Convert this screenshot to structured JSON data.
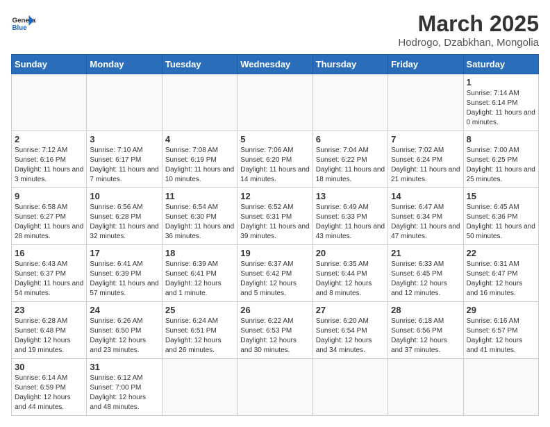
{
  "header": {
    "logo_general": "General",
    "logo_blue": "Blue",
    "main_title": "March 2025",
    "subtitle": "Hodrogo, Dzabkhan, Mongolia"
  },
  "weekdays": [
    "Sunday",
    "Monday",
    "Tuesday",
    "Wednesday",
    "Thursday",
    "Friday",
    "Saturday"
  ],
  "weeks": [
    [
      {
        "day": "",
        "info": ""
      },
      {
        "day": "",
        "info": ""
      },
      {
        "day": "",
        "info": ""
      },
      {
        "day": "",
        "info": ""
      },
      {
        "day": "",
        "info": ""
      },
      {
        "day": "",
        "info": ""
      },
      {
        "day": "1",
        "info": "Sunrise: 7:14 AM\nSunset: 6:14 PM\nDaylight: 11 hours and 0 minutes."
      }
    ],
    [
      {
        "day": "2",
        "info": "Sunrise: 7:12 AM\nSunset: 6:16 PM\nDaylight: 11 hours and 3 minutes."
      },
      {
        "day": "3",
        "info": "Sunrise: 7:10 AM\nSunset: 6:17 PM\nDaylight: 11 hours and 7 minutes."
      },
      {
        "day": "4",
        "info": "Sunrise: 7:08 AM\nSunset: 6:19 PM\nDaylight: 11 hours and 10 minutes."
      },
      {
        "day": "5",
        "info": "Sunrise: 7:06 AM\nSunset: 6:20 PM\nDaylight: 11 hours and 14 minutes."
      },
      {
        "day": "6",
        "info": "Sunrise: 7:04 AM\nSunset: 6:22 PM\nDaylight: 11 hours and 18 minutes."
      },
      {
        "day": "7",
        "info": "Sunrise: 7:02 AM\nSunset: 6:24 PM\nDaylight: 11 hours and 21 minutes."
      },
      {
        "day": "8",
        "info": "Sunrise: 7:00 AM\nSunset: 6:25 PM\nDaylight: 11 hours and 25 minutes."
      }
    ],
    [
      {
        "day": "9",
        "info": "Sunrise: 6:58 AM\nSunset: 6:27 PM\nDaylight: 11 hours and 28 minutes."
      },
      {
        "day": "10",
        "info": "Sunrise: 6:56 AM\nSunset: 6:28 PM\nDaylight: 11 hours and 32 minutes."
      },
      {
        "day": "11",
        "info": "Sunrise: 6:54 AM\nSunset: 6:30 PM\nDaylight: 11 hours and 36 minutes."
      },
      {
        "day": "12",
        "info": "Sunrise: 6:52 AM\nSunset: 6:31 PM\nDaylight: 11 hours and 39 minutes."
      },
      {
        "day": "13",
        "info": "Sunrise: 6:49 AM\nSunset: 6:33 PM\nDaylight: 11 hours and 43 minutes."
      },
      {
        "day": "14",
        "info": "Sunrise: 6:47 AM\nSunset: 6:34 PM\nDaylight: 11 hours and 47 minutes."
      },
      {
        "day": "15",
        "info": "Sunrise: 6:45 AM\nSunset: 6:36 PM\nDaylight: 11 hours and 50 minutes."
      }
    ],
    [
      {
        "day": "16",
        "info": "Sunrise: 6:43 AM\nSunset: 6:37 PM\nDaylight: 11 hours and 54 minutes."
      },
      {
        "day": "17",
        "info": "Sunrise: 6:41 AM\nSunset: 6:39 PM\nDaylight: 11 hours and 57 minutes."
      },
      {
        "day": "18",
        "info": "Sunrise: 6:39 AM\nSunset: 6:41 PM\nDaylight: 12 hours and 1 minute."
      },
      {
        "day": "19",
        "info": "Sunrise: 6:37 AM\nSunset: 6:42 PM\nDaylight: 12 hours and 5 minutes."
      },
      {
        "day": "20",
        "info": "Sunrise: 6:35 AM\nSunset: 6:44 PM\nDaylight: 12 hours and 8 minutes."
      },
      {
        "day": "21",
        "info": "Sunrise: 6:33 AM\nSunset: 6:45 PM\nDaylight: 12 hours and 12 minutes."
      },
      {
        "day": "22",
        "info": "Sunrise: 6:31 AM\nSunset: 6:47 PM\nDaylight: 12 hours and 16 minutes."
      }
    ],
    [
      {
        "day": "23",
        "info": "Sunrise: 6:28 AM\nSunset: 6:48 PM\nDaylight: 12 hours and 19 minutes."
      },
      {
        "day": "24",
        "info": "Sunrise: 6:26 AM\nSunset: 6:50 PM\nDaylight: 12 hours and 23 minutes."
      },
      {
        "day": "25",
        "info": "Sunrise: 6:24 AM\nSunset: 6:51 PM\nDaylight: 12 hours and 26 minutes."
      },
      {
        "day": "26",
        "info": "Sunrise: 6:22 AM\nSunset: 6:53 PM\nDaylight: 12 hours and 30 minutes."
      },
      {
        "day": "27",
        "info": "Sunrise: 6:20 AM\nSunset: 6:54 PM\nDaylight: 12 hours and 34 minutes."
      },
      {
        "day": "28",
        "info": "Sunrise: 6:18 AM\nSunset: 6:56 PM\nDaylight: 12 hours and 37 minutes."
      },
      {
        "day": "29",
        "info": "Sunrise: 6:16 AM\nSunset: 6:57 PM\nDaylight: 12 hours and 41 minutes."
      }
    ],
    [
      {
        "day": "30",
        "info": "Sunrise: 6:14 AM\nSunset: 6:59 PM\nDaylight: 12 hours and 44 minutes."
      },
      {
        "day": "31",
        "info": "Sunrise: 6:12 AM\nSunset: 7:00 PM\nDaylight: 12 hours and 48 minutes."
      },
      {
        "day": "",
        "info": ""
      },
      {
        "day": "",
        "info": ""
      },
      {
        "day": "",
        "info": ""
      },
      {
        "day": "",
        "info": ""
      },
      {
        "day": "",
        "info": ""
      }
    ]
  ]
}
